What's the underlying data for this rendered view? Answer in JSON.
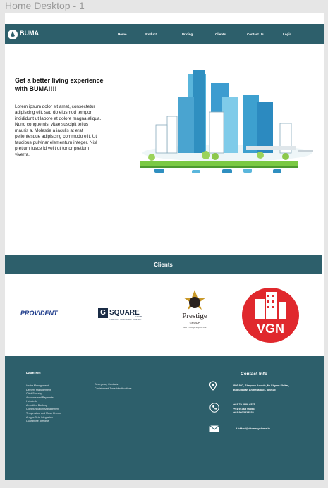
{
  "frame_title": "Home Desktop - 1",
  "nav": {
    "brand": "BUMA",
    "links": [
      "Home",
      "Product",
      "Pricing",
      "Clients",
      "Contact Us",
      "Login"
    ]
  },
  "hero": {
    "title": "Get a better living experience with BUMA!!!!",
    "body": "Lorem ipsum dolor sit amet, consectetur adipiscing elit, sed do eiusmod tempor incididunt ut labore et dolore magna aliqua. Nunc congue nisi vitae suscipit tellus mauris a. Molestie a iaculis at erat pellentesque adipiscing commodo elit. Ut faucibus pulvinar elementum integer. Nisl pretium fusce id velit ut tortor pretium viverra."
  },
  "clients": {
    "heading": "Clients",
    "logos": {
      "provident": "PROVIDENT",
      "gsquare_g": "G",
      "gsquare_word": "SQUARE",
      "gsquare_sub": "GROUP",
      "gsquare_tag": "YOUR PLOT. YOUR WORLD. YOUR WAY.",
      "prestige": "Prestige",
      "prestige_group": "GROUP",
      "prestige_tag": "Add Prestige to your Life",
      "vgn": "VGN"
    }
  },
  "footer": {
    "features_heading": "Features",
    "features_col1": [
      "Visitor Management",
      "Delivery Management",
      "Child Security",
      "Accounts and Payments",
      "Helpdesk",
      "Amenities Booking",
      "Communication Management",
      "Temperature and Mask Checks",
      "Arogya Setu Integration",
      "Quarantine at Home"
    ],
    "features_col2": [
      "Emergency Contacts",
      "Containment Zone Identifications"
    ],
    "contact_heading": "Contact Info",
    "address": [
      "806-807, Shayona Arcade, Nr Shyam Shikar,",
      "Bopunagar, Ahmedabad - 380025"
    ],
    "phones": [
      "+91 79 4800 6575",
      "+91 91065 96983",
      "+91 9033323525"
    ],
    "email": "d.bkkod@divinesystems.in"
  },
  "colors": {
    "brand": "#2d5f6b",
    "provident": "#1c3a8a",
    "prestige_gold": "#c9992a",
    "vgn_red": "#e0282d"
  }
}
